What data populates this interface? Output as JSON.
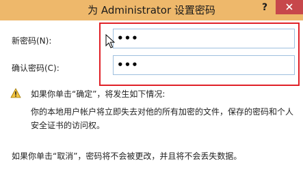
{
  "window": {
    "title": "为 Administrator 设置密码",
    "help_label": "?"
  },
  "form": {
    "new_password_label": "新密码(N):",
    "new_password_value": "•••",
    "confirm_password_label": "确认密码(C):",
    "confirm_password_value": "•••"
  },
  "warning": {
    "heading": "如果你单击“确定”，将发生如下情况:",
    "body_line1": "你的本地用户帐户将立即失去对他的所有加密的文件，保存的密码和个人",
    "body_line2": "安全证书的访问权。",
    "cancel_note": "如果你单击“取消”，密码将不会被更改，并且将不会丢失数据。"
  },
  "colors": {
    "titlebar": "#eeb86b",
    "close_button": "#c7474b",
    "highlight_border": "#e01f26",
    "input_border": "#9dbfde"
  },
  "icons": [
    "close-icon",
    "warning-icon",
    "mouse-cursor-icon"
  ]
}
